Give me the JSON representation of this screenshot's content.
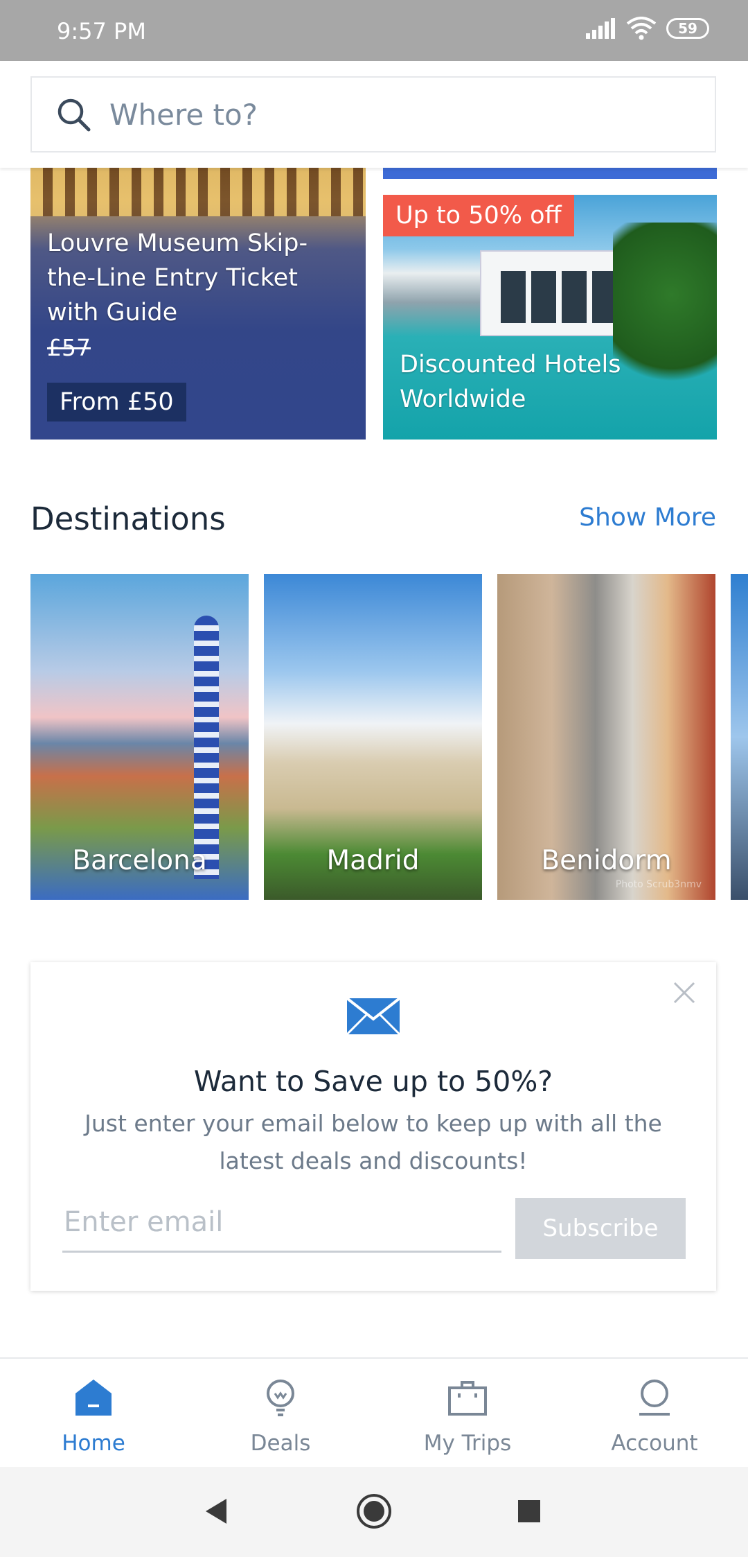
{
  "status_bar": {
    "time": "9:57 PM",
    "battery": "59"
  },
  "search": {
    "placeholder": "Where to?"
  },
  "featured": {
    "louvre": {
      "title": "Louvre Museum Skip-the-Line Entry Ticket with Guide",
      "old_price": "£57",
      "price": "From £50"
    },
    "hotels": {
      "badge": "Up to 50% off",
      "title": "Discounted Hotels Worldwide"
    }
  },
  "destinations": {
    "heading": "Destinations",
    "show_more": "Show More",
    "items": [
      {
        "label": "Barcelona"
      },
      {
        "label": "Madrid"
      },
      {
        "label": "Benidorm"
      }
    ],
    "watermark": "Photo Scrub3nmv"
  },
  "newsletter": {
    "heading": "Want to Save up to 50%?",
    "subtext": "Just enter your email below to keep up with all the latest deals and discounts!",
    "email_placeholder": "Enter email",
    "button": "Subscribe"
  },
  "tabs": [
    {
      "label": "Home",
      "icon": "home-icon",
      "active": true
    },
    {
      "label": "Deals",
      "icon": "lightbulb-icon",
      "active": false
    },
    {
      "label": "My Trips",
      "icon": "briefcase-icon",
      "active": false
    },
    {
      "label": "Account",
      "icon": "account-icon",
      "active": false
    }
  ],
  "colors": {
    "accent": "#2d7cd1",
    "badge": "#f25a4a",
    "subscribe_disabled": "#d2d6db"
  }
}
